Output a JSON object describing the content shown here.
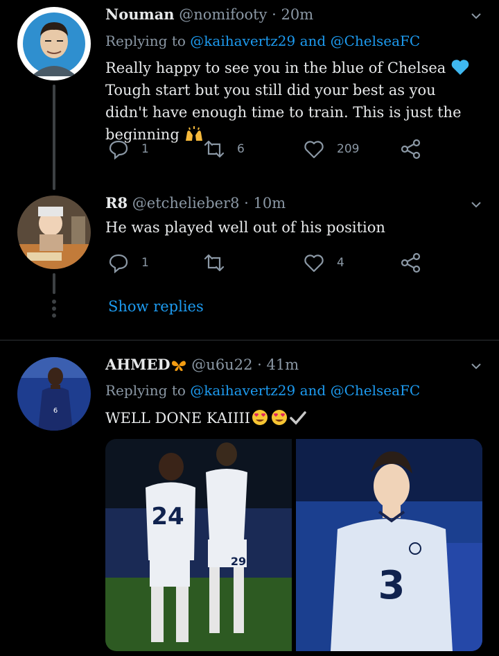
{
  "tweets": [
    {
      "name": "Nouman",
      "handle": "@nomifooty",
      "separator": "·",
      "time": "20m",
      "replying_prefix": "Replying to",
      "replying_to_1": "@kaihavertz29",
      "replying_and": "and",
      "replying_to_2": "@ChelseaFC",
      "text_part1": "Really happy to see you in the blue of Chelsea",
      "text_part2": "Tough start but you still did your best as you didn't have enough time to train. This is just the beginning",
      "reply_count": "1",
      "retweet_count": "6",
      "like_count": "209"
    },
    {
      "name": "R8",
      "handle": "@etchelieber8",
      "separator": "·",
      "time": "10m",
      "text": "He was played well out of his position",
      "reply_count": "1",
      "retweet_count": "",
      "like_count": "4"
    },
    {
      "name": "AHMED",
      "handle": "@u6u22",
      "separator": "·",
      "time": "41m",
      "replying_prefix": "Replying to",
      "replying_to_1": "@kaihavertz29",
      "replying_and": "and",
      "replying_to_2": "@ChelseaFC",
      "text": "WELL DONE KAIIII",
      "photo1_number_a": "24",
      "photo1_number_b": "29",
      "photo2_number": "3"
    }
  ],
  "show_replies": "Show replies",
  "icons": [
    "chevron-down-icon",
    "reply-icon",
    "retweet-icon",
    "like-icon",
    "share-icon",
    "heart-emoji-icon",
    "raised-hands-emoji-icon",
    "butterfly-emoji-icon",
    "heart-eyes-emoji-icon",
    "check-mark-icon"
  ],
  "colors": {
    "background": "#000000",
    "accent": "#1d9bf0",
    "muted": "#8b98a5",
    "text": "#e7e9ea",
    "divider": "#2f3336"
  }
}
